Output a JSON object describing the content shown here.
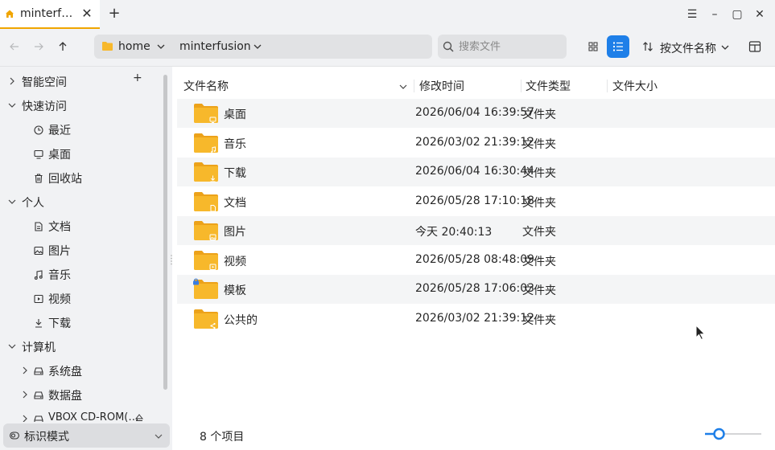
{
  "tab": {
    "title": "minterf…",
    "close": "✕",
    "new_tab": "+"
  },
  "window_controls": {
    "menu": "☰",
    "minimize": "–",
    "maximize": "▢",
    "close": "✕"
  },
  "breadcrumb": {
    "items": [
      "home",
      "minterfusion"
    ]
  },
  "search": {
    "placeholder": "搜索文件"
  },
  "sort": {
    "label": "按文件名称"
  },
  "sidebar": {
    "groups": [
      {
        "label": "智能空间",
        "expanded": false,
        "add": "+"
      },
      {
        "label": "快速访问",
        "expanded": true
      },
      {
        "label": "个人",
        "expanded": true
      },
      {
        "label": "计算机",
        "expanded": true
      }
    ],
    "quick": [
      {
        "label": "最近",
        "icon": "clock-icon"
      },
      {
        "label": "桌面",
        "icon": "monitor-icon"
      },
      {
        "label": "回收站",
        "icon": "trash-icon"
      }
    ],
    "personal": [
      {
        "label": "文档",
        "icon": "document-icon"
      },
      {
        "label": "图片",
        "icon": "image-icon"
      },
      {
        "label": "音乐",
        "icon": "music-icon"
      },
      {
        "label": "视频",
        "icon": "video-icon"
      },
      {
        "label": "下载",
        "icon": "download-icon"
      }
    ],
    "computer": [
      {
        "label": "系统盘",
        "icon": "drive-icon"
      },
      {
        "label": "数据盘",
        "icon": "drive-icon"
      },
      {
        "label": "VBOX CD-ROM(…",
        "icon": "cdrom-icon"
      }
    ],
    "mode": {
      "label": "标识模式"
    }
  },
  "columns": {
    "name": "文件名称",
    "mtime": "修改时间",
    "type": "文件类型",
    "size": "文件大小"
  },
  "files": [
    {
      "name": "桌面",
      "mtime": "2026/06/04 16:39:57",
      "type": "文件夹",
      "size": "",
      "emblem": "monitor"
    },
    {
      "name": "音乐",
      "mtime": "2026/03/02 21:39:12",
      "type": "文件夹",
      "size": "",
      "emblem": "music"
    },
    {
      "name": "下载",
      "mtime": "2026/06/04 16:30:44",
      "type": "文件夹",
      "size": "",
      "emblem": "download"
    },
    {
      "name": "文档",
      "mtime": "2026/05/28 17:10:18",
      "type": "文件夹",
      "size": "",
      "emblem": "document"
    },
    {
      "name": "图片",
      "mtime": "今天 20:40:13",
      "type": "文件夹",
      "size": "",
      "emblem": "image"
    },
    {
      "name": "视频",
      "mtime": "2026/05/28 08:48:09",
      "type": "文件夹",
      "size": "",
      "emblem": "video"
    },
    {
      "name": "模板",
      "mtime": "2026/05/28 17:06:03",
      "type": "文件夹",
      "size": "",
      "emblem": "lock"
    },
    {
      "name": "公共的",
      "mtime": "2026/03/02 21:39:12",
      "type": "文件夹",
      "size": "",
      "emblem": "share"
    }
  ],
  "status": {
    "count": "8 个项目"
  },
  "zoom": {
    "level": 0.25
  },
  "colors": {
    "accent": "#1e7fe8",
    "folder": "#f7b82b",
    "folder_dark": "#eca21a",
    "tab_highlight": "#f0a500"
  }
}
